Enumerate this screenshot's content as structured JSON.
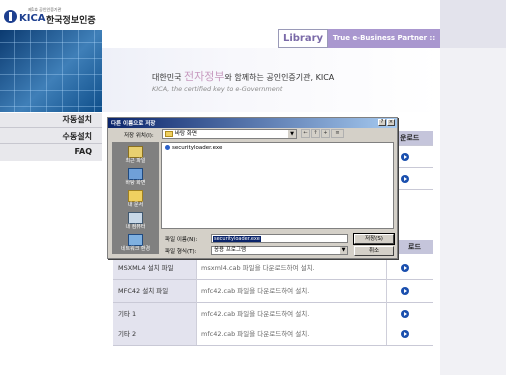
{
  "logo": {
    "small_text": "제1호 공인인증기관",
    "brand": "KICA",
    "korean_name": "한국정보인증"
  },
  "left_menu": {
    "items": [
      "자동설치",
      "수동설치",
      "FAQ"
    ]
  },
  "header": {
    "library_tab": "Library",
    "partner_tab": "True e-Business Partner ::"
  },
  "banner": {
    "line1_prefix": "대한민국 ",
    "line1_highlight": "전자정부",
    "line1_suffix": "와 함께하는 공인인증기관, KICA",
    "line2": "KICA, the certified key to e-Government"
  },
  "top_table": {
    "header_download_partial": "운로드"
  },
  "bottom_table": {
    "header_download_partial": "로드",
    "rows": [
      {
        "name": "MSXML4 설치 파일",
        "desc": "msxml4.cab 파일을 다운로드하여 설치."
      },
      {
        "name": "MFC42 설치 파일",
        "desc": "mfc42.cab 파일을 다운로드하여 설치."
      },
      {
        "name": "기타 1",
        "desc": "mfc42.cab 파일을 다운로드하여 설치."
      },
      {
        "name": "기타 2",
        "desc": "mfc42.cab 파일을 다운로드하여 설치."
      }
    ]
  },
  "dialog": {
    "title": "다른 이름으로 저장",
    "look_in_label": "저장 위치(I):",
    "look_in_value": "바탕 화면",
    "places": [
      "최근 파일",
      "바탕 화면",
      "내 문서",
      "내 컴퓨터",
      "네트워크 환경"
    ],
    "files": [
      "securityloader.exe"
    ],
    "filename_label": "파일 이름(N):",
    "filename_value": "securityloader.exe",
    "filetype_label": "파일 형식(T):",
    "filetype_value": "응용 프로그램",
    "save_button": "저장(S)",
    "cancel_button": "취소"
  }
}
